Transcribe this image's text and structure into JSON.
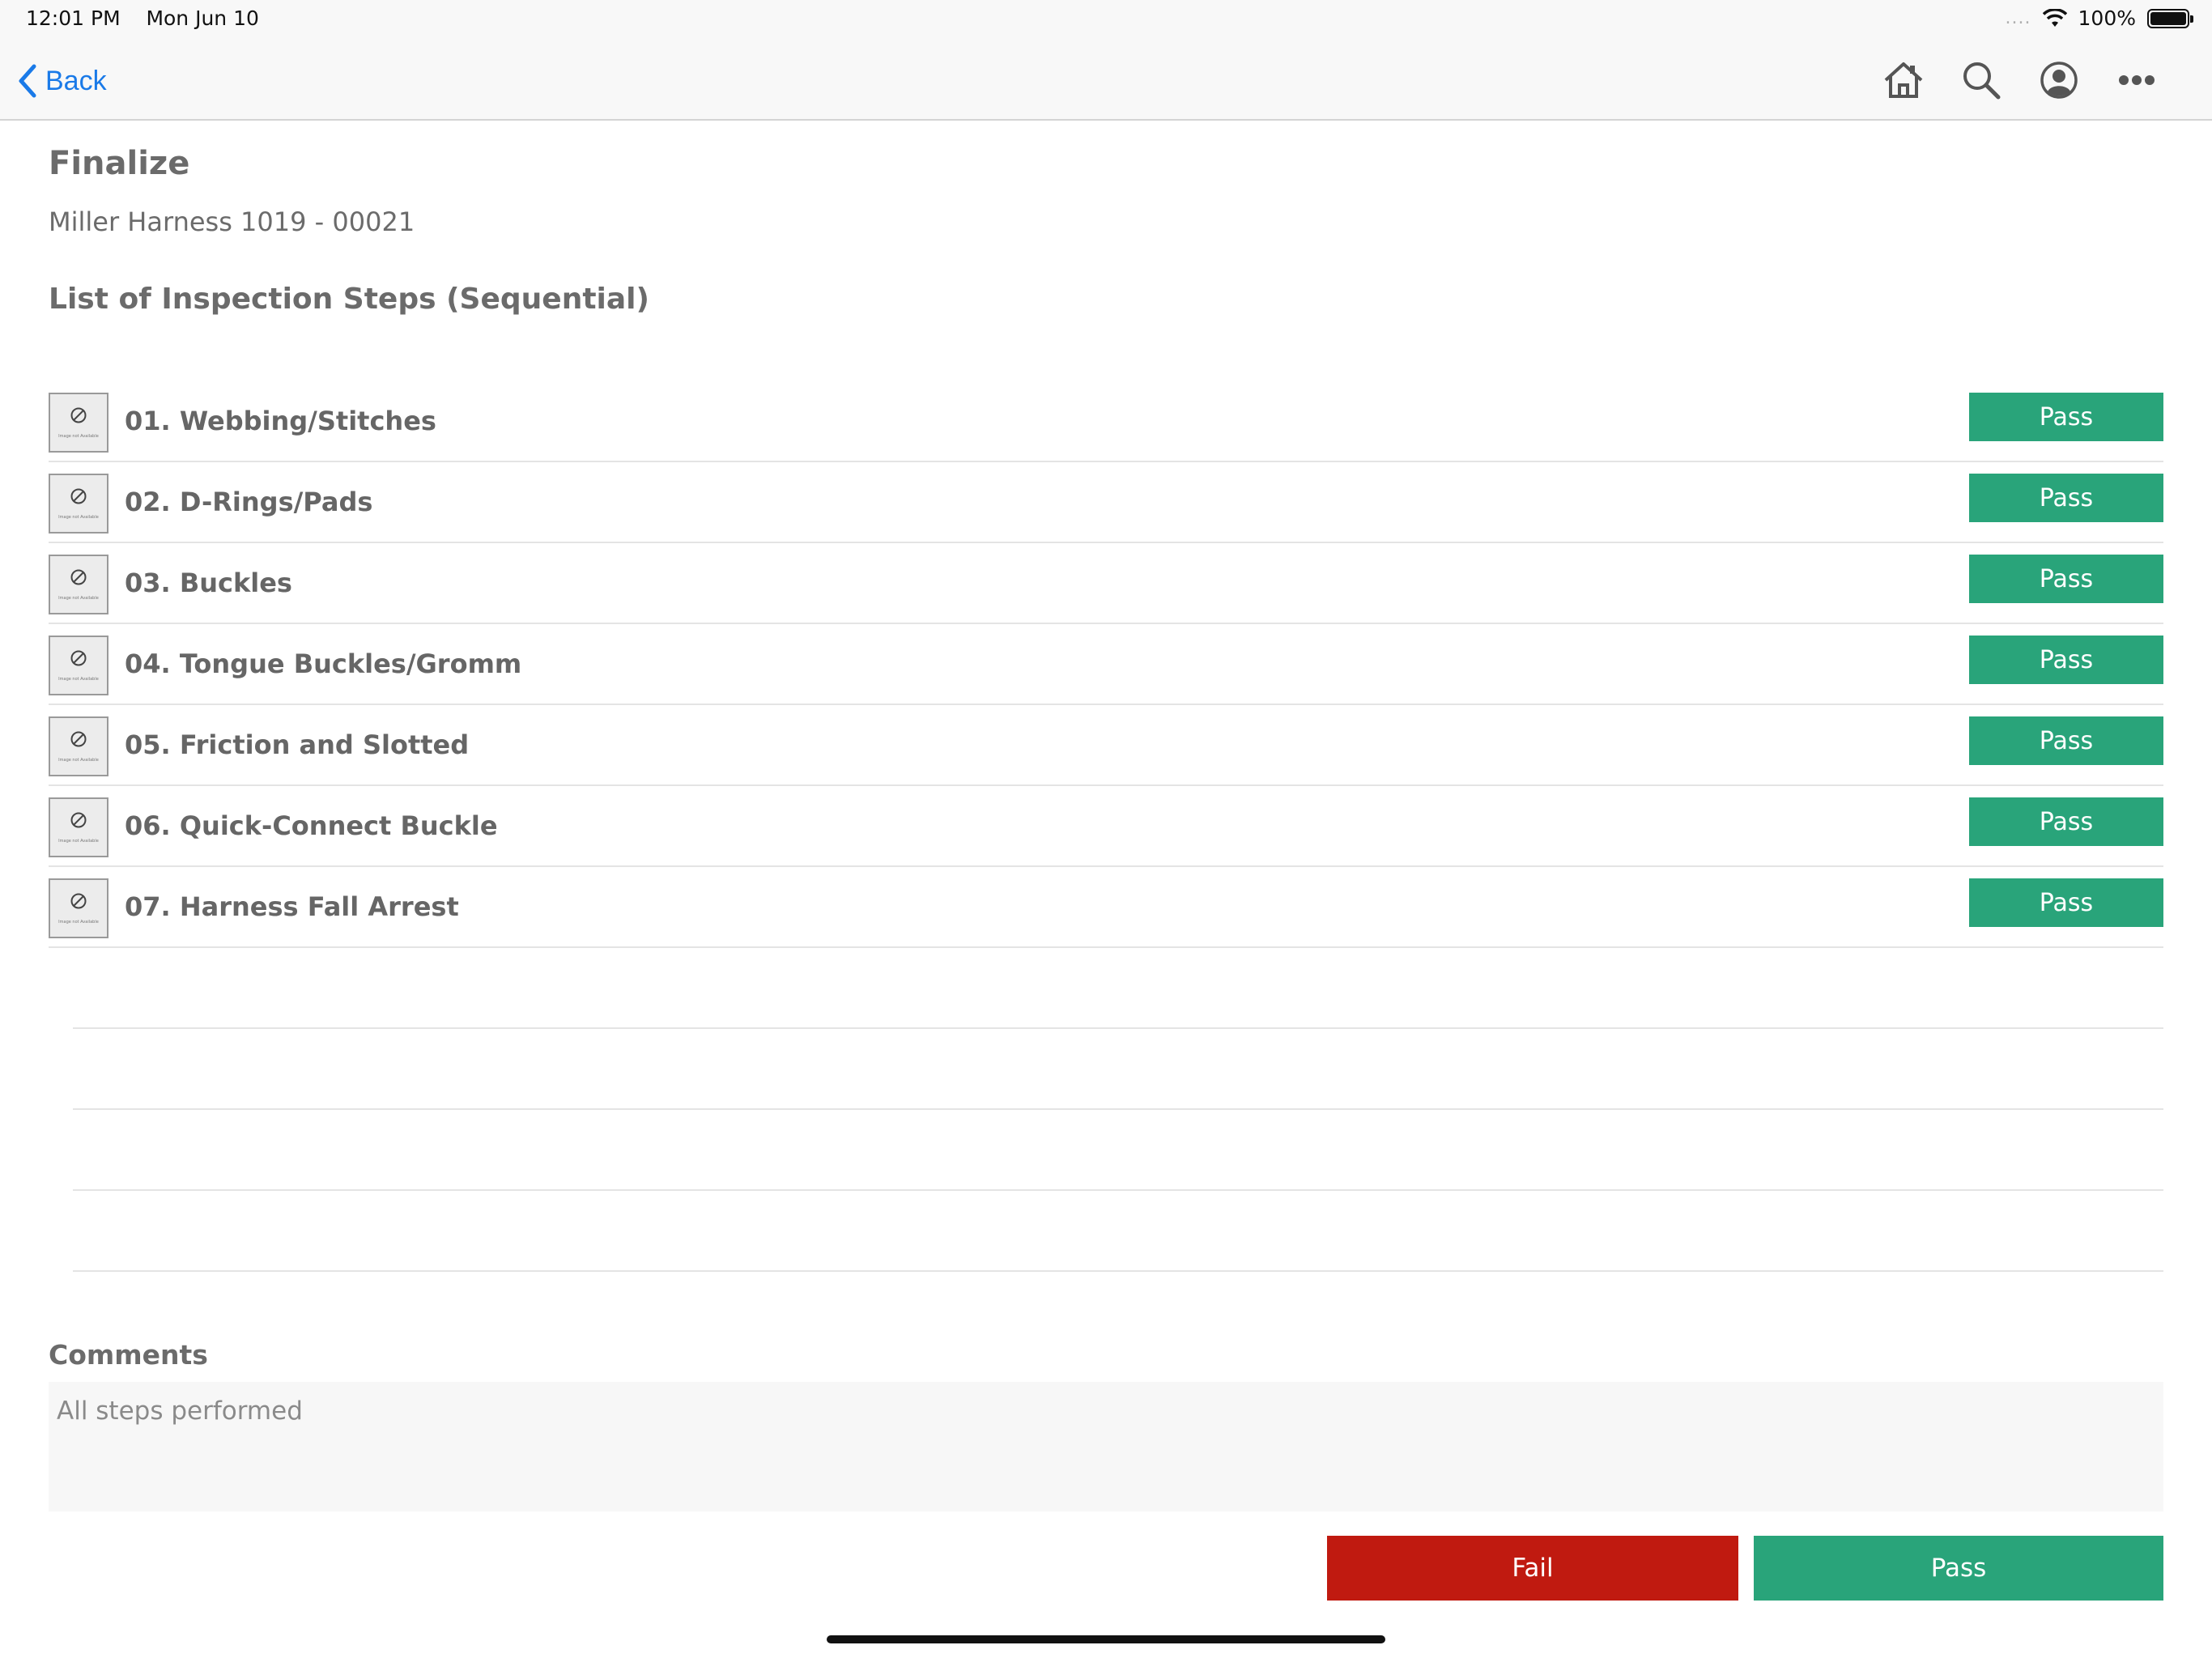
{
  "status_bar": {
    "time": "12:01 PM",
    "date": "Mon Jun 10",
    "signal": "....",
    "battery": "100%"
  },
  "nav": {
    "back_label": "Back",
    "icons": [
      "home-icon",
      "search-icon",
      "account-icon",
      "more-icon"
    ]
  },
  "page": {
    "title": "Finalize",
    "subtitle": "Miller Harness 1019 - 00021",
    "section_title": "List of Inspection Steps (Sequential)"
  },
  "steps": [
    {
      "label": "01. Webbing/Stitches",
      "status": "Pass"
    },
    {
      "label": "02. D-Rings/Pads",
      "status": "Pass"
    },
    {
      "label": "03. Buckles",
      "status": "Pass"
    },
    {
      "label": "04. Tongue Buckles/Gromm",
      "status": "Pass"
    },
    {
      "label": "05. Friction and Slotted",
      "status": "Pass"
    },
    {
      "label": "06. Quick-Connect Buckle",
      "status": "Pass"
    },
    {
      "label": "07. Harness Fall Arrest",
      "status": "Pass"
    }
  ],
  "thumb_caption": "Image not Available",
  "comments": {
    "label": "Comments",
    "value": "All steps performed"
  },
  "actions": {
    "fail_label": "Fail",
    "pass_label": "Pass"
  },
  "colors": {
    "pass": "#29a47a",
    "fail": "#c01a10",
    "link": "#1a7ae8"
  }
}
